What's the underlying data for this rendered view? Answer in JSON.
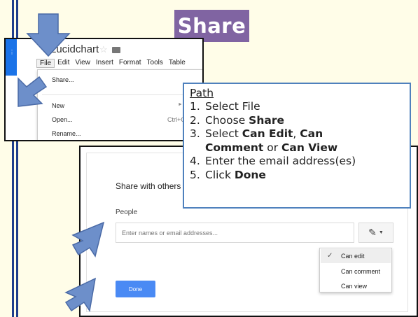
{
  "title": "Share",
  "menu_screenshot": {
    "app_name": "Lucidchart",
    "menu_items": [
      "File",
      "Edit",
      "View",
      "Insert",
      "Format",
      "Tools",
      "Table"
    ],
    "dropdown": {
      "share": "Share...",
      "new": "New",
      "open": "Open...",
      "open_shortcut": "Ctrl+O",
      "rename": "Rename..."
    }
  },
  "path": {
    "heading": "Path",
    "steps": [
      {
        "num": "1.",
        "parts": [
          {
            "t": "Select File",
            "b": false
          }
        ]
      },
      {
        "num": "2.",
        "parts": [
          {
            "t": "Choose ",
            "b": false
          },
          {
            "t": "Share",
            "b": true
          }
        ]
      },
      {
        "num": "3.",
        "parts": [
          {
            "t": "Select ",
            "b": false
          },
          {
            "t": "Can Edit",
            "b": true
          },
          {
            "t": ", ",
            "b": false
          },
          {
            "t": "Can",
            "b": true
          }
        ]
      },
      {
        "num": "",
        "parts": [
          {
            "t": "Comment",
            "b": true
          },
          {
            "t": " or ",
            "b": false
          },
          {
            "t": "Can View",
            "b": true
          }
        ]
      },
      {
        "num": "4.",
        "parts": [
          {
            "t": "Enter the email address(es)",
            "b": false
          }
        ]
      },
      {
        "num": "5.",
        "parts": [
          {
            "t": "Click ",
            "b": false
          },
          {
            "t": "Done",
            "b": true
          }
        ]
      }
    ]
  },
  "dialog": {
    "heading": "Share with others",
    "people_label": "People",
    "email_placeholder": "Enter names or email addresses...",
    "permissions": {
      "can_edit": "Can edit",
      "can_comment": "Can comment",
      "can_view": "Can view",
      "selected": "Can edit"
    },
    "done_label": "Done"
  },
  "colors": {
    "title_bg": "#8064a2",
    "path_border": "#4f81bd",
    "arrow_fill": "#6d8fca",
    "page_bg": "#fffde8",
    "done_button": "#4a8af4"
  }
}
